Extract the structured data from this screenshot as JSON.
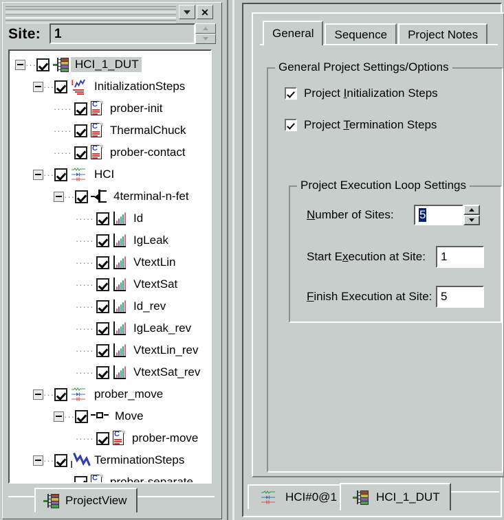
{
  "left_window": {
    "caption_buttons": [
      {
        "name": "restore",
        "glyph": "▼"
      },
      {
        "name": "close",
        "glyph": "✕"
      }
    ],
    "site": {
      "label": "Site:",
      "value": "1",
      "placeholder": ""
    },
    "tree": [
      {
        "label": "HCI_1_DUT",
        "depth": 0,
        "expander": "minus",
        "checked": true,
        "icon": "dut-icon",
        "selected": true
      },
      {
        "label": "InitializationSteps",
        "depth": 1,
        "expander": "minus",
        "checked": true,
        "icon": "init-steps-icon",
        "selected": false
      },
      {
        "label": "prober-init",
        "depth": 2,
        "expander": "none",
        "checked": true,
        "icon": "document-icon",
        "selected": false
      },
      {
        "label": "ThermalChuck",
        "depth": 2,
        "expander": "none",
        "checked": true,
        "icon": "document-icon",
        "selected": false
      },
      {
        "label": "prober-contact",
        "depth": 2,
        "expander": "none",
        "checked": true,
        "icon": "document-icon",
        "selected": false
      },
      {
        "label": "HCI",
        "depth": 1,
        "expander": "minus",
        "checked": true,
        "icon": "module-icon",
        "selected": false
      },
      {
        "label": "4terminal-n-fet",
        "depth": 2,
        "expander": "minus",
        "checked": true,
        "icon": "transistor-icon",
        "selected": false
      },
      {
        "label": "Id",
        "depth": 3,
        "expander": "none",
        "checked": true,
        "icon": "graph-icon",
        "selected": false
      },
      {
        "label": "IgLeak",
        "depth": 3,
        "expander": "none",
        "checked": true,
        "icon": "graph-icon",
        "selected": false
      },
      {
        "label": "VtextLin",
        "depth": 3,
        "expander": "none",
        "checked": true,
        "icon": "graph-icon",
        "selected": false
      },
      {
        "label": "VtextSat",
        "depth": 3,
        "expander": "none",
        "checked": true,
        "icon": "graph-icon",
        "selected": false
      },
      {
        "label": "Id_rev",
        "depth": 3,
        "expander": "none",
        "checked": true,
        "icon": "graph-icon",
        "selected": false
      },
      {
        "label": "IgLeak_rev",
        "depth": 3,
        "expander": "none",
        "checked": true,
        "icon": "graph-icon",
        "selected": false
      },
      {
        "label": "VtextLin_rev",
        "depth": 3,
        "expander": "none",
        "checked": true,
        "icon": "graph-icon",
        "selected": false
      },
      {
        "label": "VtextSat_rev",
        "depth": 3,
        "expander": "none",
        "checked": true,
        "icon": "graph-icon",
        "selected": false
      },
      {
        "label": "prober_move",
        "depth": 1,
        "expander": "minus",
        "checked": true,
        "icon": "module-icon",
        "selected": false
      },
      {
        "label": "Move",
        "depth": 2,
        "expander": "minus",
        "checked": true,
        "icon": "move-icon",
        "selected": false
      },
      {
        "label": "prober-move",
        "depth": 3,
        "expander": "none",
        "checked": true,
        "icon": "document-icon",
        "selected": false
      },
      {
        "label": "TerminationSteps",
        "depth": 1,
        "expander": "minus",
        "checked": true,
        "icon": "termination-steps-icon",
        "selected": false
      },
      {
        "label": "prober-separate",
        "depth": 2,
        "expander": "none",
        "checked": true,
        "icon": "document-icon",
        "selected": false
      }
    ],
    "bottom_tab": {
      "label": "ProjectView",
      "icon": "dut-icon",
      "active": true
    }
  },
  "right_window": {
    "tabs": [
      {
        "label": "General",
        "active": true
      },
      {
        "label": "Sequence",
        "active": false
      },
      {
        "label": "Project Notes",
        "active": false
      }
    ],
    "general_group": {
      "title": "General Project Settings/Options",
      "checkboxes": [
        {
          "label_pre": "Project ",
          "accel": "I",
          "label_post": "nitialization Steps",
          "checked": true
        },
        {
          "label_pre": "Project ",
          "accel": "T",
          "label_post": "ermination Steps",
          "checked": true
        }
      ],
      "loop_group": {
        "title": "Project Execution Loop Settings",
        "fields": [
          {
            "label_pre": "",
            "accel": "N",
            "label_post": "umber of Sites:",
            "value": "5",
            "selected": true,
            "spinner": true
          },
          {
            "label_pre": "Start E",
            "accel": "x",
            "label_post": "ecution at Site:",
            "value": "1",
            "selected": false,
            "spinner": false
          },
          {
            "label_pre": "",
            "accel": "F",
            "label_post": "inish Execution at Site:",
            "value": "5",
            "selected": false,
            "spinner": false
          }
        ]
      }
    },
    "bottom_tabs": [
      {
        "label": "HCI#0@1",
        "icon": "module-icon",
        "active": false
      },
      {
        "label": "HCI_1_DUT",
        "icon": "dut-icon",
        "active": true
      }
    ]
  },
  "colors": {
    "face": "#c8cecb",
    "desktop": "#c3c9c7",
    "selection": "#0a246a",
    "tree_selected": "#c9cecc",
    "accent_red": "#d93a3a",
    "accent_blue": "#2f3fae",
    "accent_green": "#2f7d32"
  }
}
